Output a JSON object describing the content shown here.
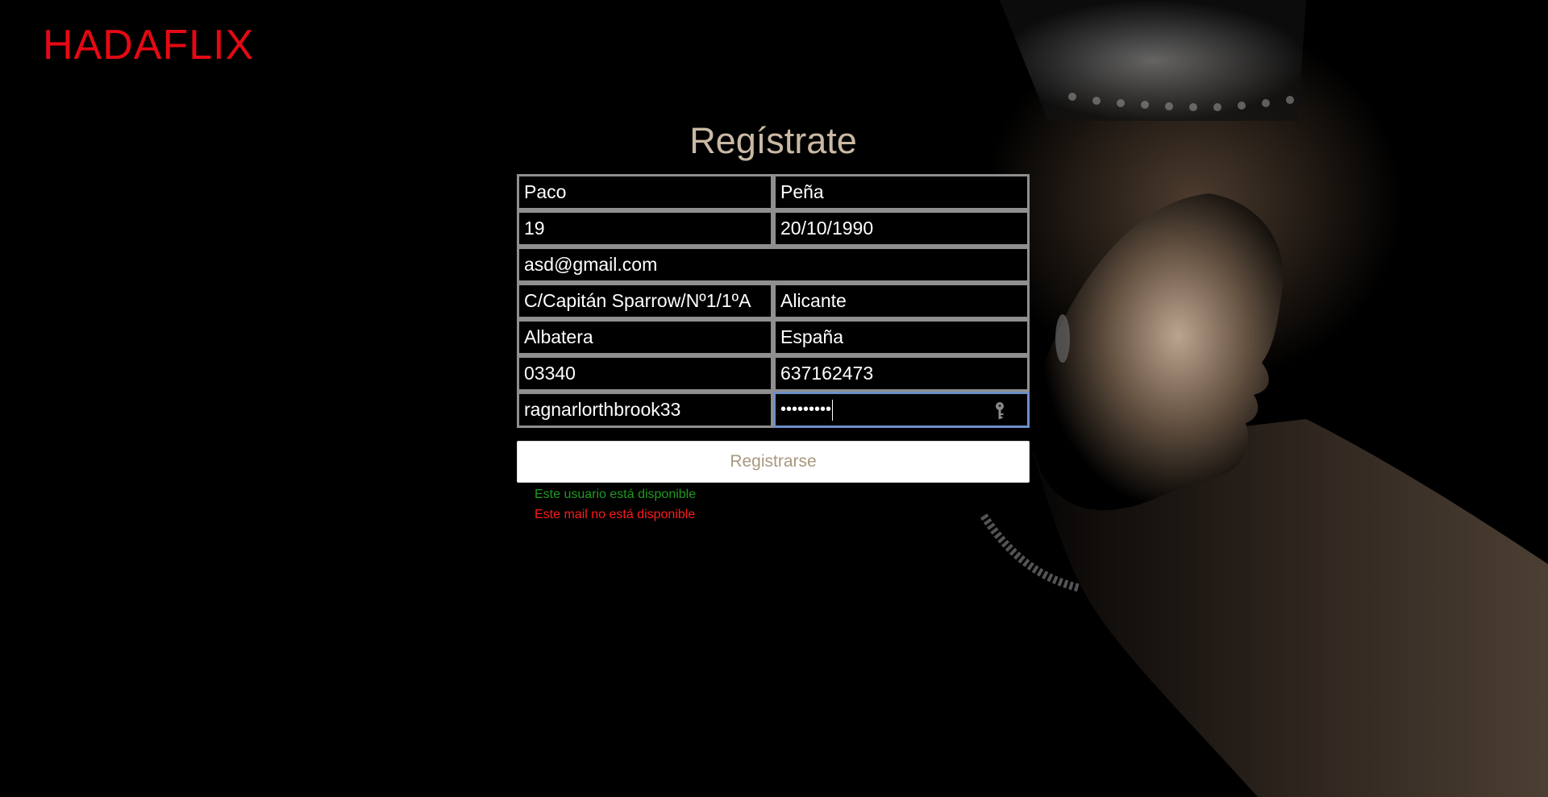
{
  "brand": {
    "name": "HADAFLIX",
    "color": "#e50914"
  },
  "form": {
    "title": "Regístrate",
    "fields": {
      "first_name": "Paco",
      "last_name": "Peña",
      "age": "19",
      "birth_date": "20/10/1990",
      "email": "asd@gmail.com",
      "address": "C/Capitán Sparrow/Nº1/1ºA",
      "province": "Alicante",
      "city": "Albatera",
      "country": "España",
      "postal_code": "03340",
      "phone": "637162473",
      "username": "ragnarlorthbrook33",
      "password_mask": "•••••••••"
    },
    "submit_label": "Registrarse",
    "messages": {
      "username_status": "Este usuario está disponible",
      "email_status": "Este mail no está disponible"
    }
  },
  "icons": {
    "password_manager": "key-icon"
  },
  "colors": {
    "title": "#c9b9a4",
    "field_border": "#8f8f8f",
    "focus_border": "#6d8fc8",
    "ok": "#1f9a1f",
    "error": "#ff1a1a"
  }
}
